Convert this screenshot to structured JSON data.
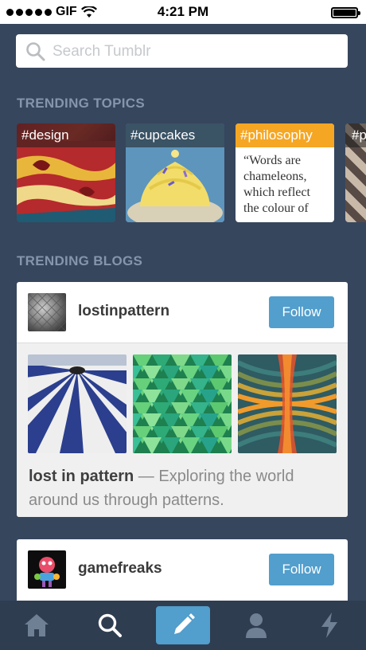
{
  "status_bar": {
    "carrier": "GIF",
    "time": "4:21 PM"
  },
  "search": {
    "placeholder": "Search Tumblr"
  },
  "trending_topics": {
    "title": "TRENDING TOPICS",
    "items": [
      {
        "tag": "#design"
      },
      {
        "tag": "#cupcakes"
      },
      {
        "tag": "#philosophy",
        "quote": "“Words are chameleons, which reflect the colour of"
      },
      {
        "tag": "#p"
      }
    ]
  },
  "trending_blogs": {
    "title": "TRENDING BLOGS",
    "items": [
      {
        "name": "lostinpattern",
        "follow_label": "Follow",
        "title": "lost in pattern",
        "description": " — Exploring the world around us through patterns."
      },
      {
        "name": "gamefreaks",
        "follow_label": "Follow"
      }
    ]
  },
  "tab_bar": {
    "tabs": [
      {
        "icon": "home-icon"
      },
      {
        "icon": "search-icon"
      },
      {
        "icon": "compose-icon",
        "active": true
      },
      {
        "icon": "account-icon"
      },
      {
        "icon": "activity-icon"
      }
    ]
  },
  "colors": {
    "background": "#36465d",
    "accent": "#529ecc",
    "tag_orange": "#f5a623"
  }
}
